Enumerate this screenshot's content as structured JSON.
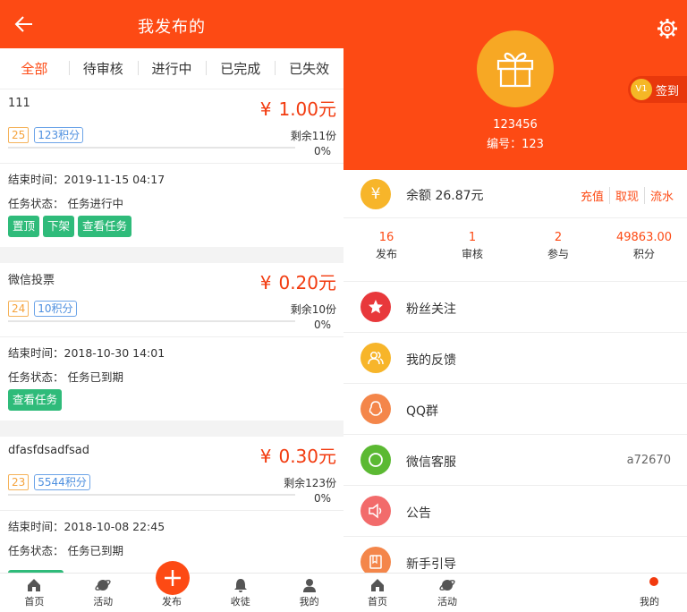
{
  "left": {
    "header": {
      "title": "我发布的"
    },
    "tabs": [
      {
        "label": "全部",
        "active": true
      },
      {
        "label": "待审核",
        "active": false
      },
      {
        "label": "进行中",
        "active": false
      },
      {
        "label": "已完成",
        "active": false
      },
      {
        "label": "已失效",
        "active": false
      }
    ],
    "tasks": [
      {
        "name": "111",
        "currency": "¥",
        "price": "1.00元",
        "num": "25",
        "points": "123积分",
        "remain": "剩余11份",
        "progress": 0,
        "percent": "0%",
        "end_time": "结束时间：2019-11-15 04:17",
        "status": "任务状态： 任务进行中",
        "buttons": [
          "置顶",
          "下架",
          "查看任务"
        ]
      },
      {
        "name": "微信投票",
        "currency": "¥",
        "price": "0.20元",
        "num": "24",
        "points": "10积分",
        "remain": "剩余10份",
        "progress": 0,
        "percent": "0%",
        "end_time": "结束时间：2018-10-30 14:01",
        "status": "任务状态： 任务已到期",
        "buttons": [
          "查看任务"
        ]
      },
      {
        "name": "dfasfdsadfsad",
        "currency": "¥",
        "price": "0.30元",
        "num": "23",
        "points": "5544积分",
        "remain": "剩余123份",
        "progress": 0,
        "percent": "0%",
        "end_time": "结束时间：2018-10-08 22:45",
        "status": "任务状态： 任务已到期",
        "buttons": []
      }
    ],
    "nav": {
      "home": "首页",
      "activity": "活动",
      "publish": "发布",
      "favorites": "收徒",
      "mine": "我的"
    },
    "colors": {
      "accent": "#fd4a14",
      "green": "#2fbb7a"
    }
  },
  "right": {
    "user": {
      "name": "123456",
      "id": "编号：123",
      "level": "V1",
      "signin": "签到"
    },
    "balance": {
      "currency_icon": "¥",
      "label": "余额 26.87元",
      "actions": [
        "充值",
        "取现",
        "流水"
      ]
    },
    "stats": [
      {
        "value": "16",
        "label": "发布"
      },
      {
        "value": "1",
        "label": "审核"
      },
      {
        "value": "2",
        "label": "参与"
      },
      {
        "value": "49863.00",
        "label": "积分"
      }
    ],
    "menu": [
      {
        "label": "粉丝关注",
        "value": "",
        "icon": "star-icon",
        "color": "#e8383b"
      },
      {
        "label": "我的反馈",
        "value": "",
        "icon": "people-icon",
        "color": "#f7b52a"
      },
      {
        "label": "QQ群",
        "value": "",
        "icon": "qq-icon",
        "color": "#f4864a"
      },
      {
        "label": "微信客服",
        "value": "a72670",
        "icon": "wechat-icon",
        "color": "#5bb932"
      },
      {
        "label": "公告",
        "value": "",
        "icon": "speaker-icon",
        "color": "#f26b6b"
      },
      {
        "label": "新手引导",
        "value": "",
        "icon": "book-icon",
        "color": "#f4864a"
      }
    ],
    "nav": {
      "home": "首页",
      "activity": "活动",
      "mine": "我的"
    }
  }
}
